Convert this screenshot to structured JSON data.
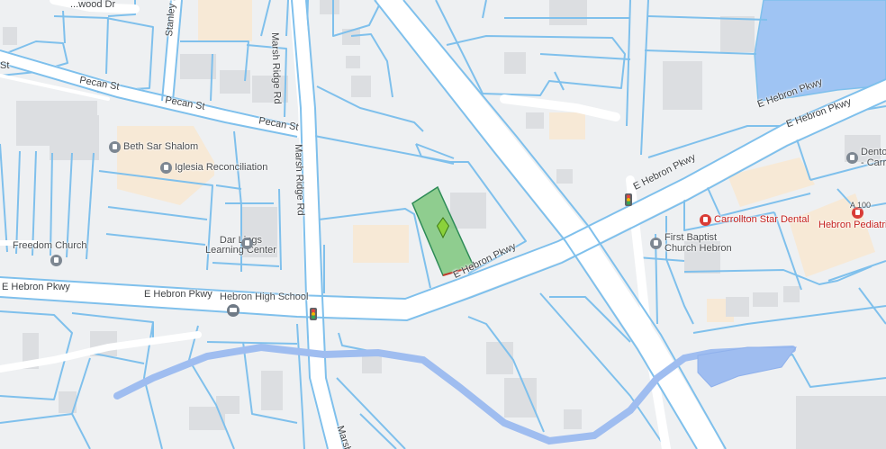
{
  "map": {
    "colors": {
      "background": "#eef0f2",
      "parcel_line": "#7fc0ec",
      "road": "#ffffff",
      "building": "#dcdee1",
      "commercial": "#f7e9d6",
      "water": "#9fc4f3",
      "highlight_parcel": "#6fc26d",
      "marker": "#8bd13a"
    },
    "streets": {
      "hebron_west": "E Hebron Pkwy",
      "hebron_mid": "E Hebron Pkwy",
      "hebron_diag": "E Hebron Pkwy",
      "hebron_east_top": "E Hebron Pkwy",
      "hebron_east_bottom": "E Hebron Pkwy",
      "hebron_center": "E Hebron Pkwy",
      "pecan_1": "Pecan St",
      "pecan_2": "Pecan St",
      "pecan_3": "Pecan St",
      "marsh_ridge_top": "Marsh Ridge Rd",
      "marsh_ridge_mid": "Marsh Ridge Rd",
      "marsh_ridge_bottom": "Marsh R",
      "stanley": "Stanley Dr",
      "wood": "...wood Dr",
      "st_left": "St"
    },
    "places": {
      "beth_sar_shalom": "Beth Sar Shalom",
      "iglesia": "Iglesia Reconciliation",
      "freedom_church": "Freedom Church",
      "darlings_1": "Dar Lings",
      "darlings_2": "Learning Center",
      "hebron_high": "Hebron High School",
      "first_baptist_1": "First Baptist",
      "first_baptist_2": "Church Hebron",
      "carrollton_star": "Carrollton Star Dental",
      "hebron_pediatrics": "Hebron Pediatrics",
      "denton_1": "Denton C",
      "denton_2": "- Carroll",
      "suite": "A 100"
    },
    "icons": {
      "place_pin": "place-pin-icon",
      "school": "school-icon",
      "medical_pin": "medical-pin-icon",
      "traffic_light": "traffic-light-icon",
      "property_marker": "property-marker-icon"
    }
  }
}
